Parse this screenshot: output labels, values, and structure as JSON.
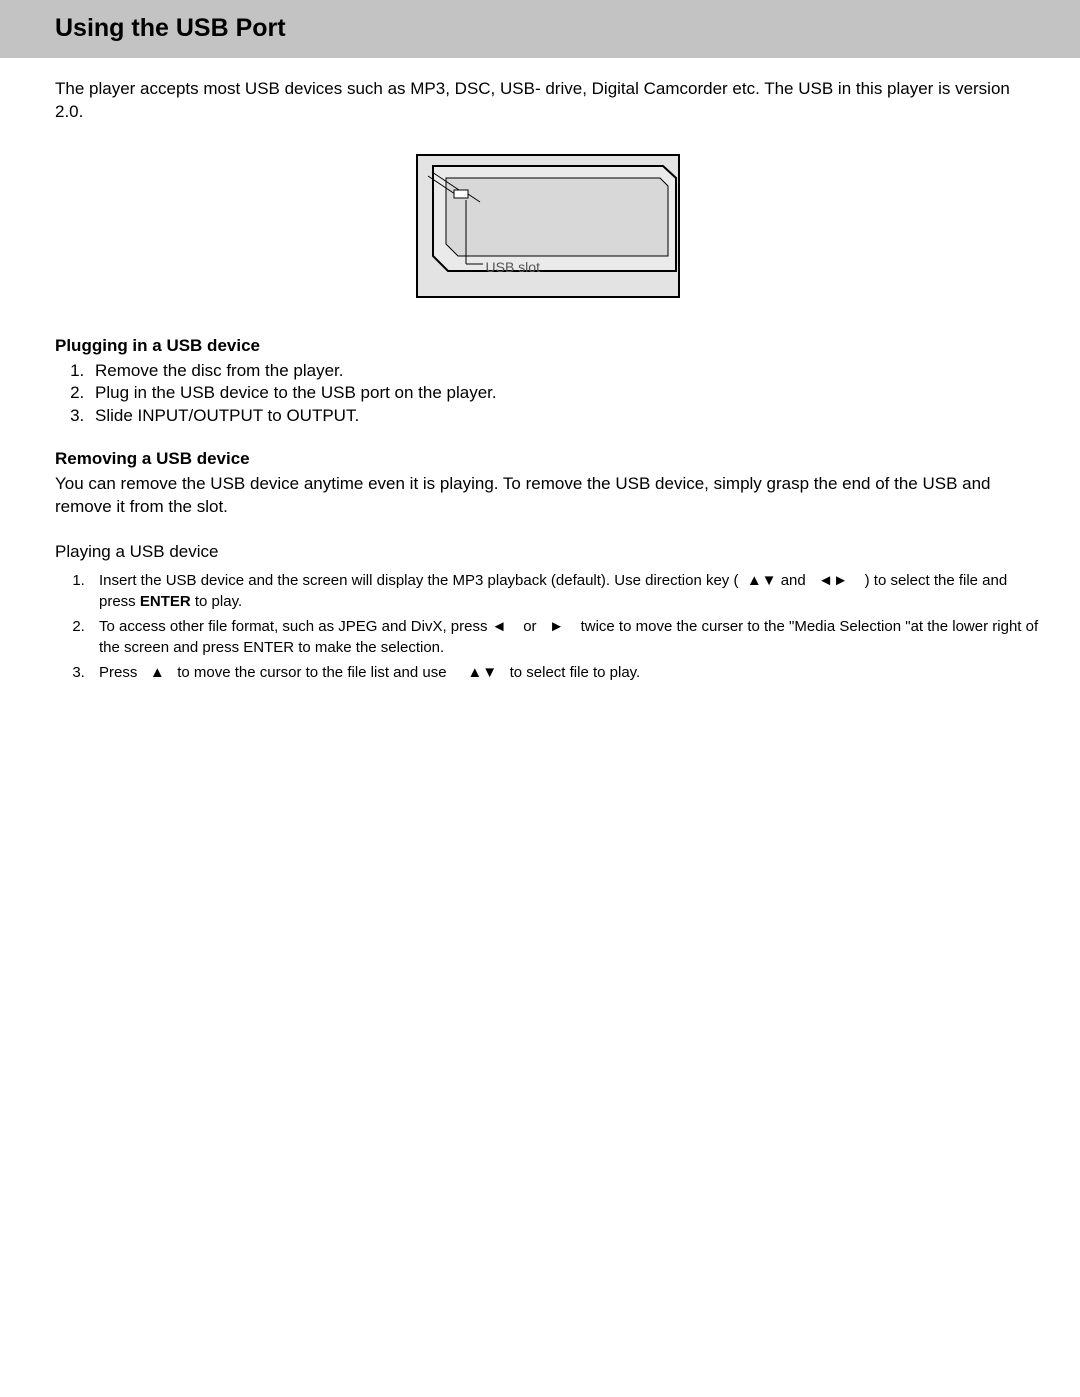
{
  "header": {
    "title": "Using the USB Port"
  },
  "intro": "The player accepts most USB devices such as MP3, DSC, USB- drive, Digital Camcorder etc. The USB in this player is version 2.0.",
  "diagram": {
    "label": "USB slot"
  },
  "plugging": {
    "title": "Plugging in a USB device",
    "items": [
      "Remove the disc from the player.",
      "Plug in the USB device to the USB port on the player.",
      "Slide INPUT/OUTPUT to OUTPUT."
    ]
  },
  "removing": {
    "title": "Removing a USB device",
    "text": "You can remove the USB device anytime even it is playing. To remove the USB device, simply grasp the end of the USB and remove it from the slot."
  },
  "playing": {
    "title": "Playing a USB device",
    "items": [
      {
        "pre": "Insert the USB device and the screen will display the MP3 playback (default). Use direction key (",
        "s1": "▲▼",
        "mid1": "and",
        "s2": "◄►",
        "post1": ") to select the file and press ",
        "enter": "ENTER",
        "post2": " to play."
      },
      {
        "pre": "To access other file format, such as JPEG and DivX, press ",
        "s1": "◄",
        "mid1": "or",
        "s2": "►",
        "post1": "twice to move the curser to the \"Media Selection \"at the lower right of the screen and press ENTER to make the selection."
      },
      {
        "pre": "Press",
        "s1": "▲",
        "mid1": "to move the cursor to the file list and use",
        "s2": "▲▼",
        "post1": "to select file to play."
      }
    ]
  }
}
